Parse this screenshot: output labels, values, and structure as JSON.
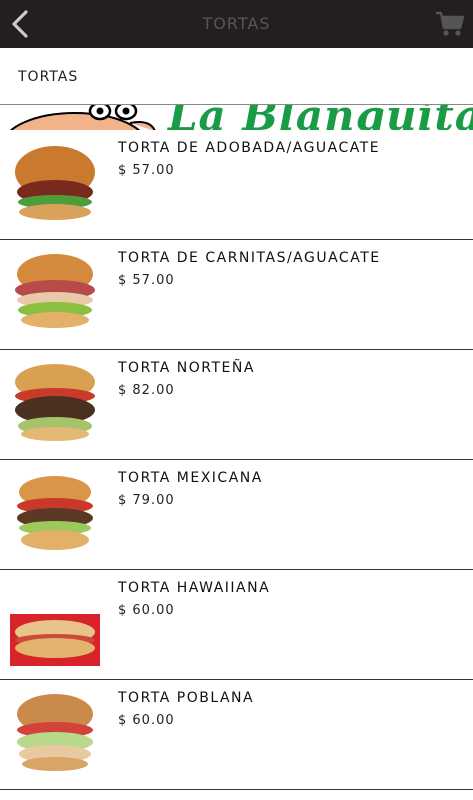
{
  "header": {
    "title": "TORTAS",
    "back_icon": "chevron-left-icon",
    "cart_icon": "shopping-cart-icon"
  },
  "section": {
    "label": "TORTAS"
  },
  "banner": {
    "brand_text": "La Blanquita"
  },
  "items": [
    {
      "name": "TORTA DE ADOBADA/AGUACATE",
      "price": "$ 57.00"
    },
    {
      "name": "TORTA DE CARNITAS/AGUACATE",
      "price": "$ 57.00"
    },
    {
      "name": "TORTA NORTEÑA",
      "price": "$ 82.00"
    },
    {
      "name": "TORTA MEXICANA",
      "price": "$ 79.00"
    },
    {
      "name": "TORTA HAWAIIANA",
      "price": "$ 60.00"
    },
    {
      "name": "TORTA POBLANA",
      "price": "$ 60.00"
    }
  ],
  "colors": {
    "topbar": "#231f1f",
    "brand_green": "#1a9b45",
    "divider": "#333333"
  }
}
